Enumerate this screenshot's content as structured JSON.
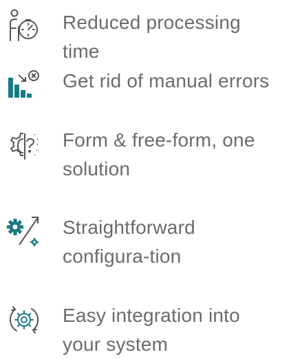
{
  "colors": {
    "text": "#6b6b6b",
    "accent": "#1a7a86",
    "outline": "#555555"
  },
  "benefits": [
    {
      "icon": "stopwatch-person-icon",
      "label": "Reduced processing time"
    },
    {
      "icon": "bar-chart-error-icon",
      "label": "Get rid of manual errors"
    },
    {
      "icon": "gear-question-icon",
      "label": "Form & free-form, one solution"
    },
    {
      "icon": "gear-arrow-icon",
      "label": "Straightforward configura-tion"
    },
    {
      "icon": "gear-cycle-icon",
      "label": "Easy integration into your system"
    }
  ]
}
